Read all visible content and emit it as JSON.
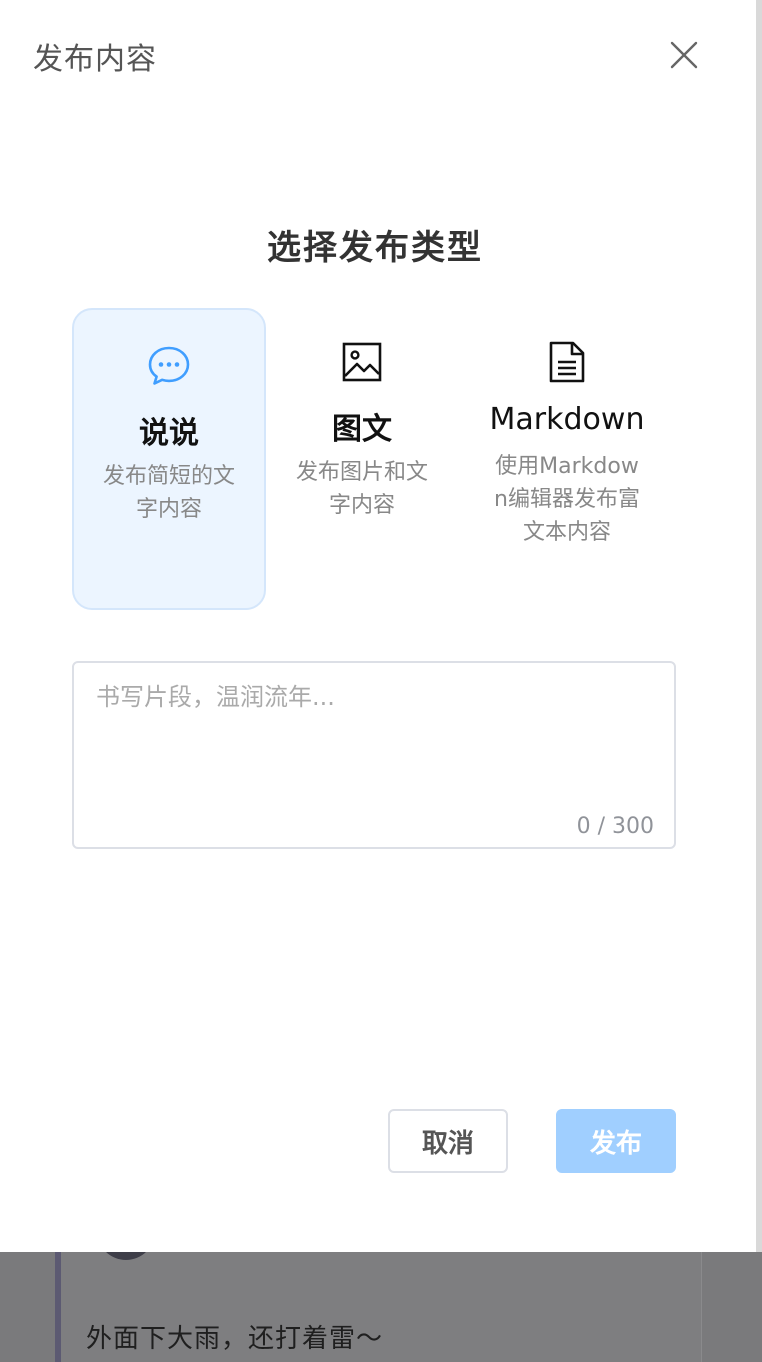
{
  "modal": {
    "title": "发布内容",
    "section_title": "选择发布类型",
    "types": [
      {
        "label": "说说",
        "description": "发布简短的文字内容",
        "icon": "chat-bubble-icon",
        "selected": true
      },
      {
        "label": "图文",
        "description": "发布图片和文字内容",
        "icon": "image-icon",
        "selected": false
      },
      {
        "label": "Markdown",
        "description": "使用Markdown编辑器发布富文本内容",
        "icon": "document-icon",
        "selected": false
      }
    ],
    "textarea": {
      "placeholder": "书写片段，温润流年...",
      "value": "",
      "count": "0 / 300"
    },
    "buttons": {
      "cancel": "取消",
      "publish": "发布"
    }
  },
  "background": {
    "post_text": "外面下大雨，还打着雷～"
  },
  "colors": {
    "accent": "#409eff",
    "selected_bg": "#ecf5ff",
    "publish_disabled": "#a0cfff"
  }
}
